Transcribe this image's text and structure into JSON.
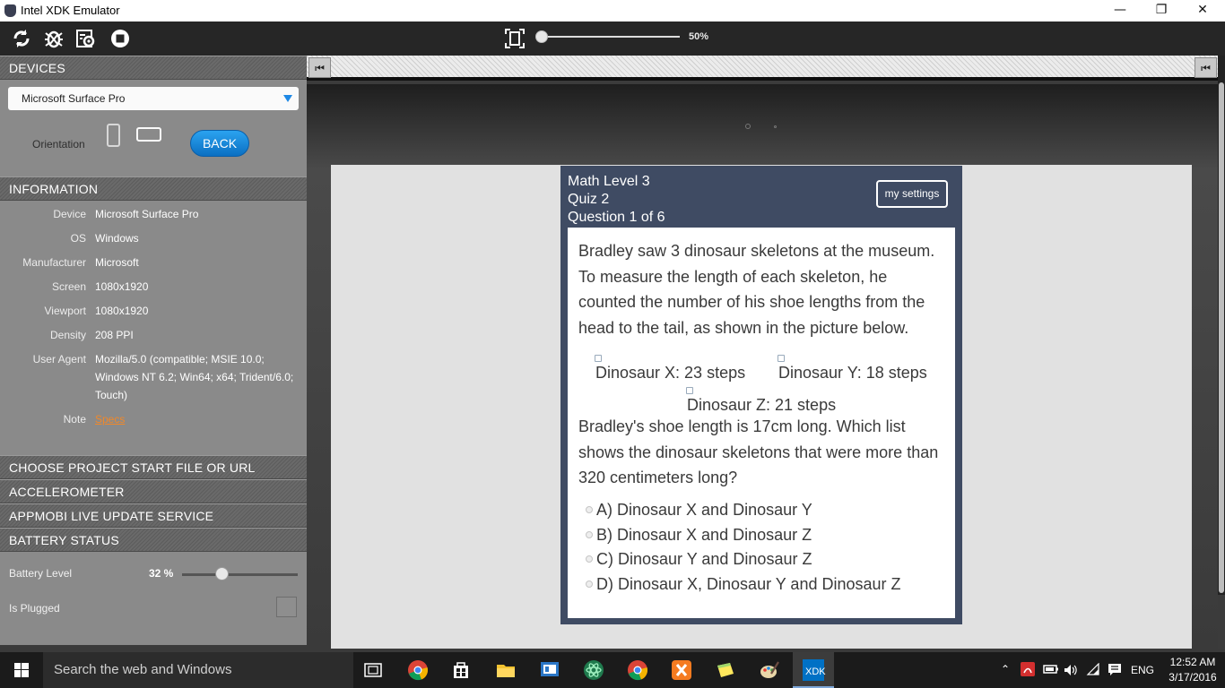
{
  "window": {
    "title": "Intel XDK Emulator",
    "minimize": "—",
    "maximize": "❐",
    "close": "✕"
  },
  "toolbar": {
    "zoom_label": "50%",
    "zoom_percent": 50,
    "icons": [
      "reload-icon",
      "debug-bug-icon",
      "settings-gear-icon",
      "stop-icon",
      "fit-screen-icon"
    ]
  },
  "panel": {
    "devices_heading": "DEVICES",
    "device_selected": "Microsoft Surface Pro",
    "orientation_label": "Orientation",
    "back_label": "BACK",
    "information_heading": "INFORMATION",
    "info": [
      {
        "key": "Device",
        "value": "Microsoft Surface Pro"
      },
      {
        "key": "OS",
        "value": "Windows"
      },
      {
        "key": "Manufacturer",
        "value": "Microsoft"
      },
      {
        "key": "Screen",
        "value": "1080x1920"
      },
      {
        "key": "Viewport",
        "value": "1080x1920"
      },
      {
        "key": "Density",
        "value": "208 PPI"
      },
      {
        "key": "User Agent",
        "value": "Mozilla/5.0 (compatible; MSIE 10.0; Windows NT 6.2; Win64; x64; Trident/6.0; Touch)"
      },
      {
        "key": "Note",
        "value": "Specs"
      }
    ],
    "sections": [
      "CHOOSE PROJECT START FILE OR URL",
      "ACCELEROMETER",
      "APPMOBI LIVE UPDATE SERVICE",
      "BATTERY STATUS"
    ],
    "battery_level_label": "Battery Level",
    "battery_level_value": "32 %",
    "battery_level_percent": 32,
    "plugged_label": "Is Plugged"
  },
  "quiz": {
    "title_line1": "Math Level 3",
    "title_line2": "Quiz 2",
    "title_line3": "Question 1 of 6",
    "settings_label": "my settings",
    "prompt": "Bradley saw 3 dinosaur skeletons at the museum. To measure the length of each skeleton, he counted the number of his shoe lengths from the head to the tail, as shown in the picture below.",
    "dino_x": "Dinosaur X: 23 steps",
    "dino_y": "Dinosaur Y: 18 steps",
    "dino_z": "Dinosaur Z: 21 steps",
    "question": "Bradley's shoe length is 17cm long. Which list shows the dinosaur skeletons that were more than 320 centimeters long?",
    "choices": [
      "A) Dinosaur X and Dinosaur Y",
      "B) Dinosaur X and Dinosaur Z",
      "C) Dinosaur Y and Dinosaur Z",
      "D) Dinosaur X, Dinosaur Y and Dinosaur Z"
    ]
  },
  "taskbar": {
    "search_placeholder": "Search the web and Windows",
    "language": "ENG",
    "time": "12:52 AM",
    "date": "3/17/2016",
    "xdk_label": "XDK"
  }
}
